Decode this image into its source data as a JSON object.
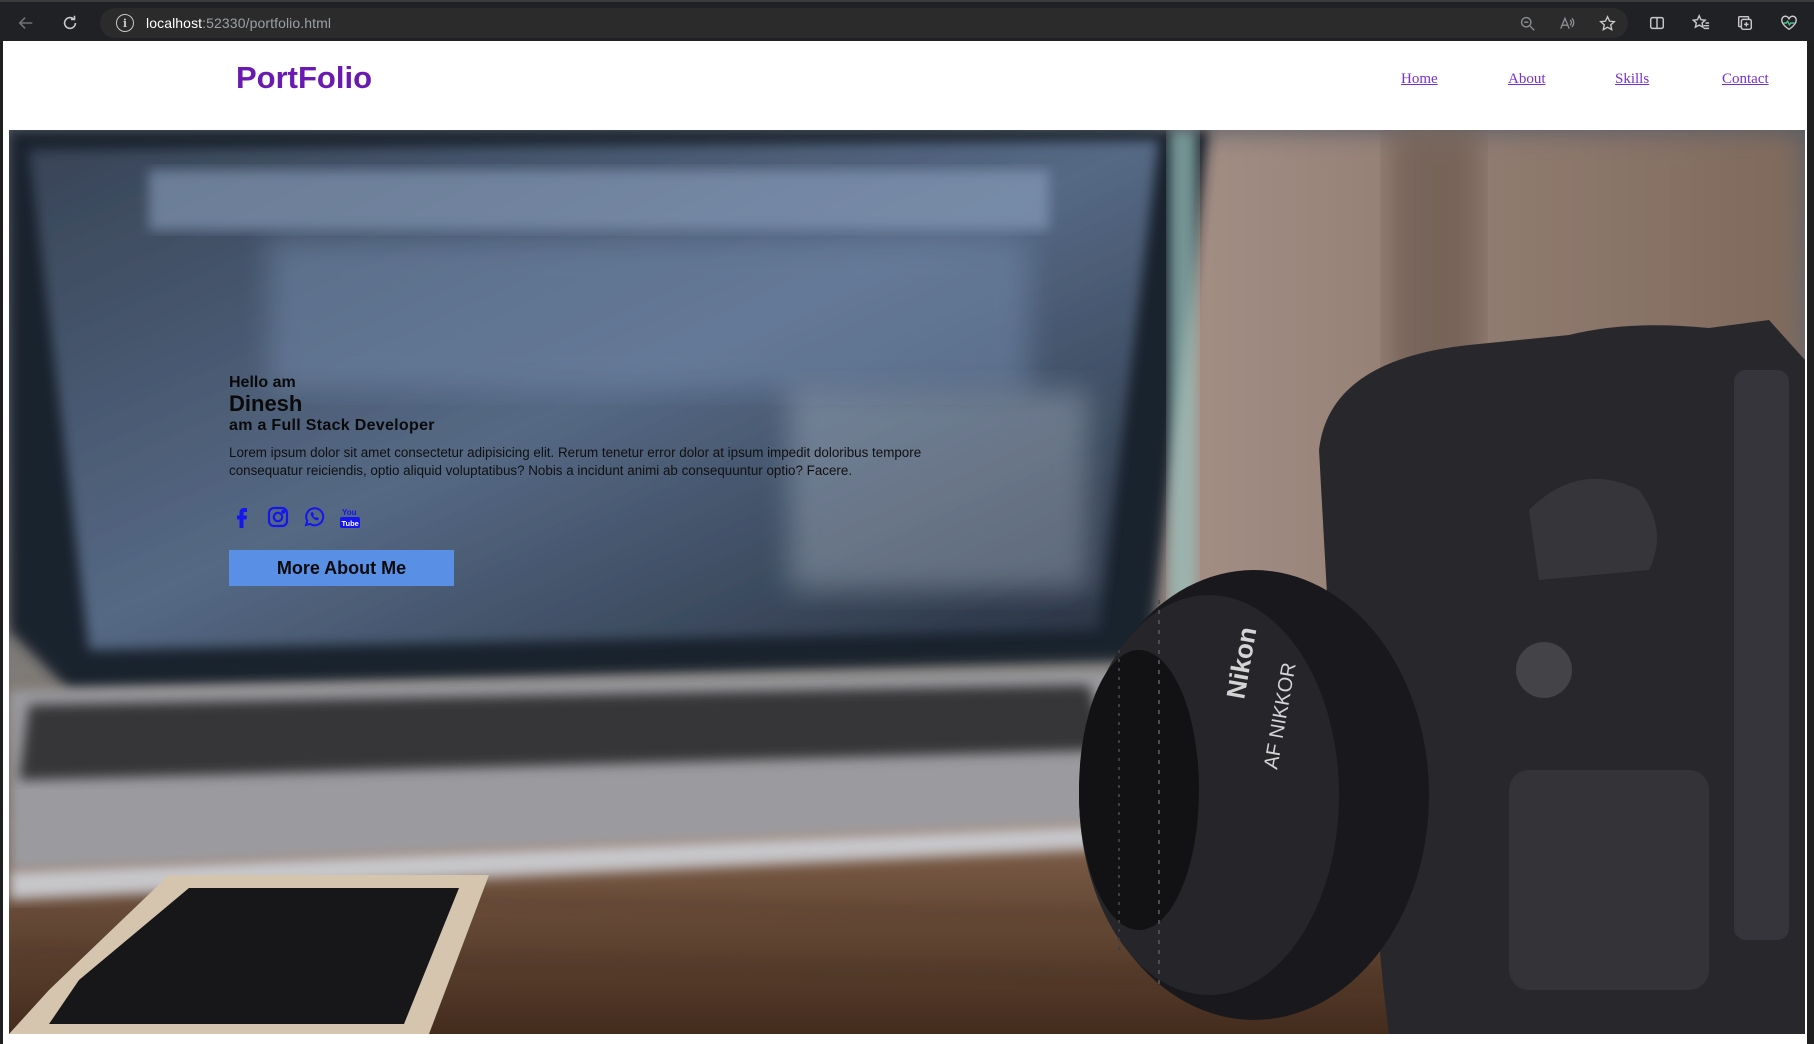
{
  "browser": {
    "url_host": "localhost",
    "url_rest": ":52330/portfolio.html",
    "icons": [
      "back-icon",
      "reload-icon",
      "info-icon",
      "zoom-out-icon",
      "read-aloud-icon",
      "favorite-star-icon",
      "split-screen-icon",
      "favorites-icon",
      "collections-icon",
      "performance-heart-icon"
    ]
  },
  "header": {
    "logo": "PortFolio",
    "nav": [
      {
        "label": "Home"
      },
      {
        "label": "About"
      },
      {
        "label": "Skills"
      },
      {
        "label": "Contact"
      }
    ]
  },
  "hero": {
    "greeting": "Hello am",
    "name": "Dinesh",
    "role": "am a Full Stack Developer",
    "description": "Lorem ipsum dolor sit amet consectetur adipisicing elit. Rerum tenetur error dolor at ipsum impedit doloribus tempore consequatur reiciendis, optio aliquid voluptatibus? Nobis a incidunt animi ab consequuntur optio? Facere.",
    "socials": [
      "facebook-icon",
      "instagram-icon",
      "whatsapp-icon",
      "youtube-icon"
    ],
    "button_label": "More About Me",
    "camera_brand": "Nikon",
    "lens_label": "AF NIKKOR"
  },
  "colors": {
    "logo": "#6a1ab0",
    "nav_link": "#7a2fd0",
    "social_icons": "#1515ee",
    "button_bg": "#5a8fe6"
  }
}
